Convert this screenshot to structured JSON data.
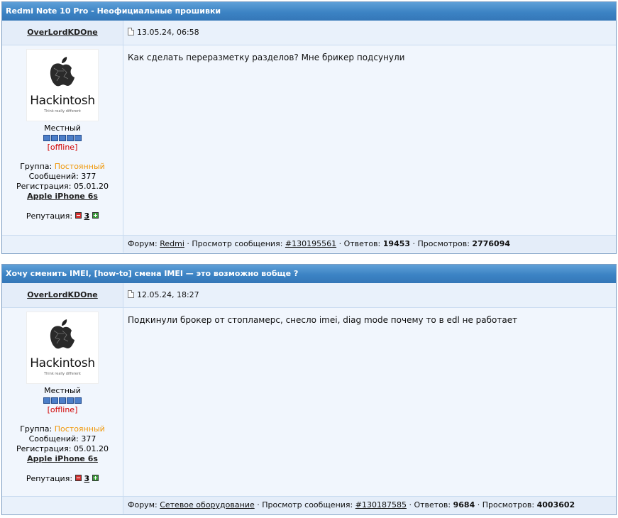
{
  "posts": [
    {
      "topic": "Redmi Note 10 Pro - Неофициальные прошивки",
      "author": "OverLordKDOne",
      "date": "13.05.24, 06:58",
      "avatar_title": "Hackintosh",
      "avatar_sub": "Think really different",
      "rank": "Местный",
      "status": "[offline]",
      "group_label": "Группа:",
      "group_value": "Постоянный",
      "posts_label": "Сообщений:",
      "posts_value": "377",
      "reg_label": "Регистрация:",
      "reg_value": "05.01.20",
      "device": "Apple iPhone 6s",
      "rep_label": "Репутация:",
      "rep_value": "3",
      "message": "Как сделать переразметку разделов? Мне брикер подсунули",
      "forum_label": "Форум:",
      "forum": "Redmi",
      "view_label": "· Просмотр сообщения:",
      "msg_id": "#130195561",
      "replies_label": "· Ответов:",
      "replies": "19453",
      "views_label": "· Просмотров:",
      "views": "2776094"
    },
    {
      "topic": "Хочу сменить IMEI, [how-to] смена IMEI — это возможно вобще ?",
      "author": "OverLordKDOne",
      "date": "12.05.24, 18:27",
      "avatar_title": "Hackintosh",
      "avatar_sub": "Think really different",
      "rank": "Местный",
      "status": "[offline]",
      "group_label": "Группа:",
      "group_value": "Постоянный",
      "posts_label": "Сообщений:",
      "posts_value": "377",
      "reg_label": "Регистрация:",
      "reg_value": "05.01.20",
      "device": "Apple iPhone 6s",
      "rep_label": "Репутация:",
      "rep_value": "3",
      "message": "Подкинули брокер от стопламерс, снесло imei, diag mode почему то в edl не работает",
      "forum_label": "Форум:",
      "forum": "Сетевое оборудование",
      "view_label": "· Просмотр сообщения:",
      "msg_id": "#130187585",
      "replies_label": "· Ответов:",
      "replies": "9684",
      "views_label": "· Просмотров:",
      "views": "4003602"
    }
  ],
  "icons": {
    "date": "document-icon",
    "avatar": "apple-logo-icon",
    "rep_minus": "minus-icon",
    "rep_plus": "plus-icon"
  },
  "colors": {
    "header": "#3c83c4",
    "group_value": "#f0980a",
    "offline": "#d00000"
  }
}
